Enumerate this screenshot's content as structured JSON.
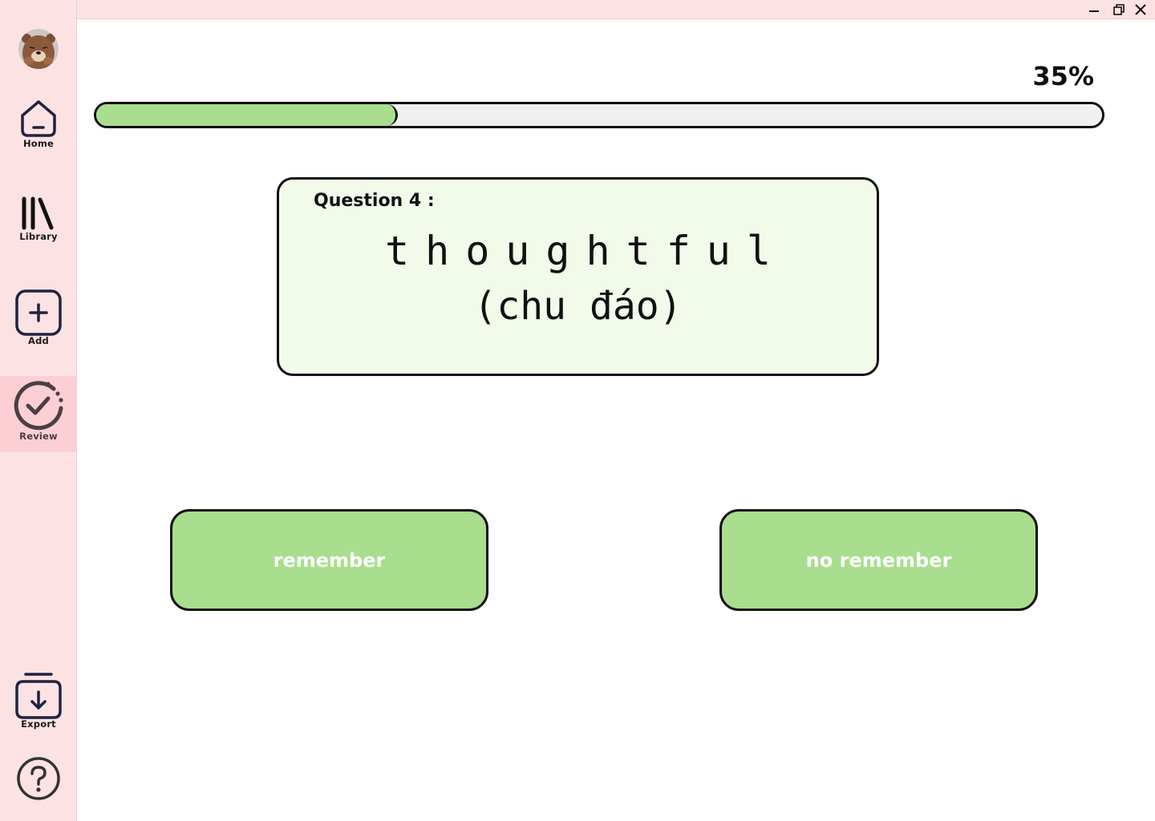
{
  "window": {
    "controls": [
      "minimize-icon",
      "restore-icon",
      "close-icon"
    ]
  },
  "sidebar": {
    "avatar": "bear-avatar",
    "items": [
      {
        "id": "home",
        "label": "Home",
        "icon": "home-icon"
      },
      {
        "id": "library",
        "label": "Library",
        "icon": "library-icon"
      },
      {
        "id": "add",
        "label": "Add",
        "icon": "add-icon"
      },
      {
        "id": "review",
        "label": "Review",
        "icon": "review-check-icon",
        "active": true
      },
      {
        "id": "export",
        "label": "Export",
        "icon": "export-icon"
      },
      {
        "id": "help",
        "label": "",
        "icon": "help-icon"
      }
    ]
  },
  "progress": {
    "label": "35%",
    "fraction": 0.3
  },
  "card": {
    "question_label": "Question 4 :",
    "word": "thoughtful",
    "meaning": "(chu đáo)"
  },
  "buttons": {
    "remember": "remember",
    "no_remember": "no remember"
  },
  "colors": {
    "sidebar_bg": "#fde2e4",
    "active_nav_bg": "#fbcfd3",
    "accent_green": "#a8de8d",
    "card_bg": "#f2fbea",
    "icon_navy": "#1f2340"
  }
}
